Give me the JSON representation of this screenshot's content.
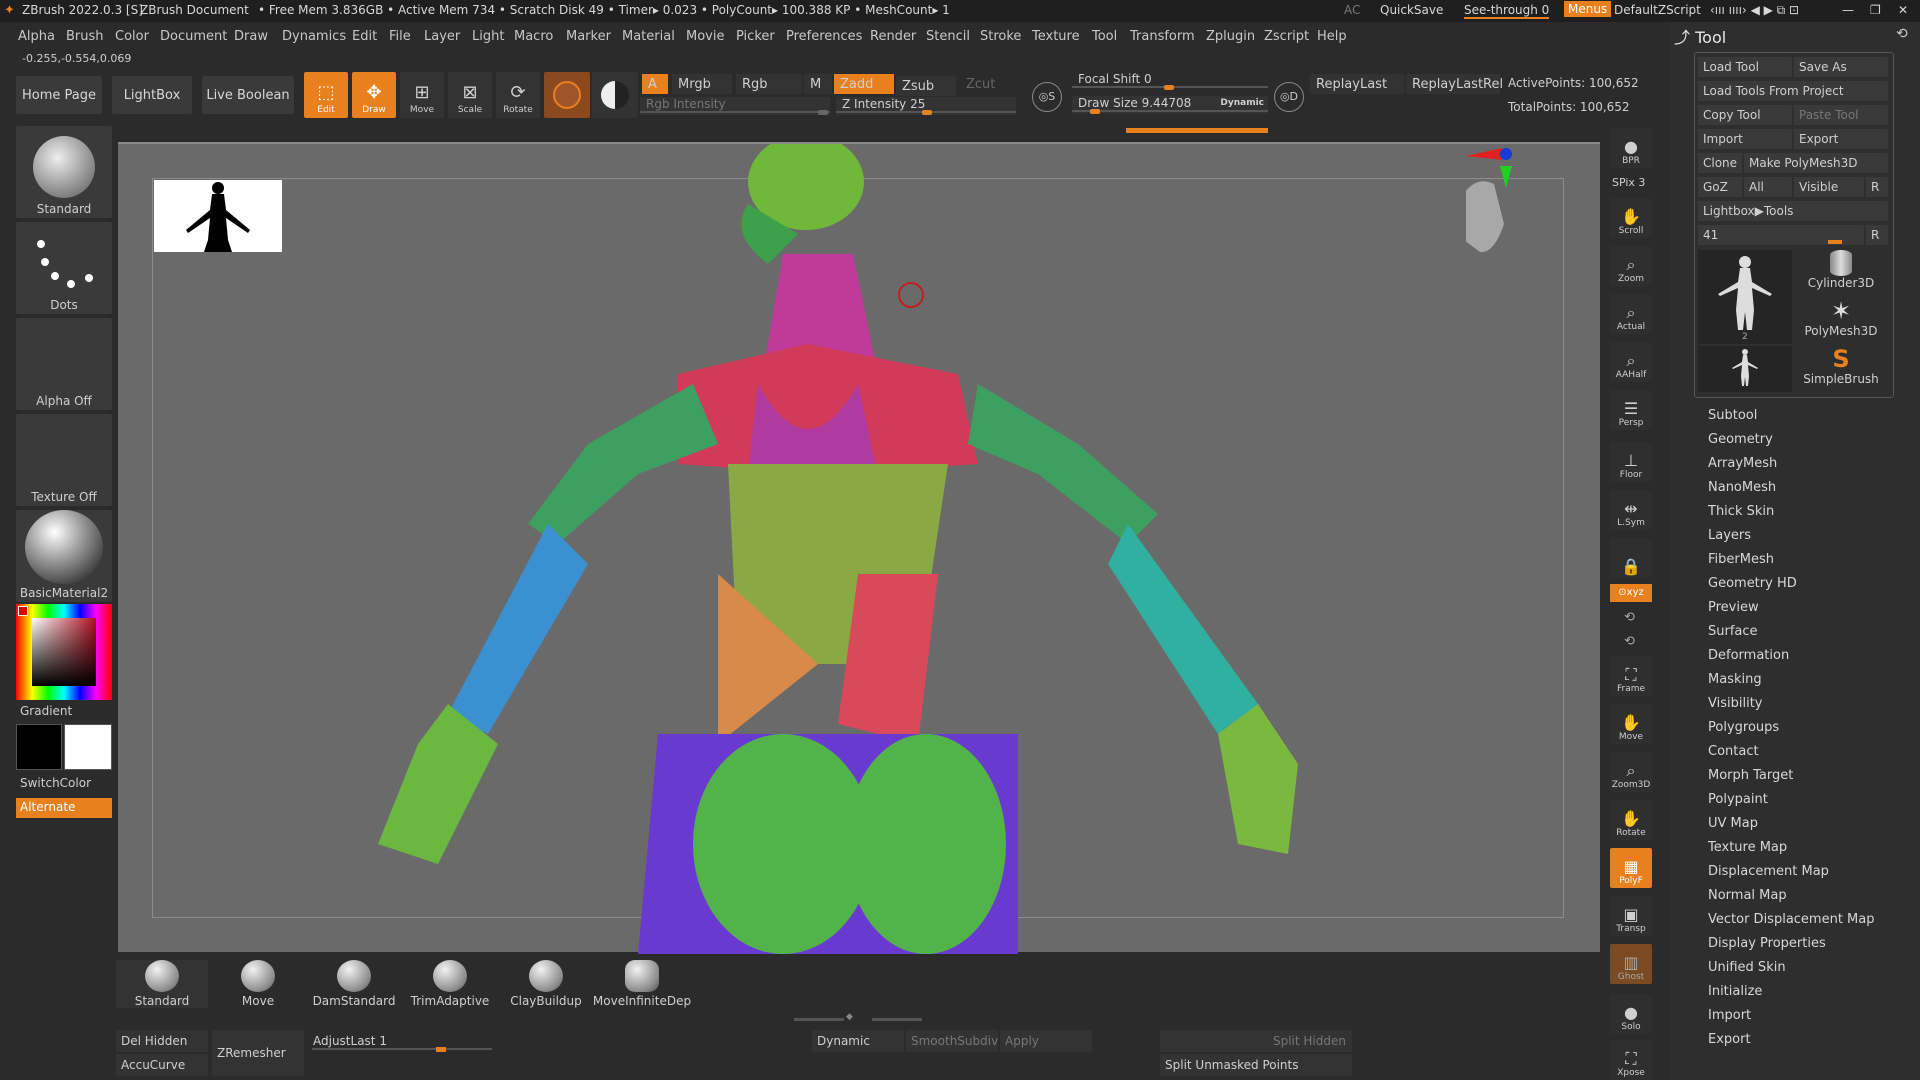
{
  "titlebar": {
    "app": "ZBrush 2022.0.3 [S]",
    "doc": "ZBrush Document",
    "stats": "• Free Mem 3.836GB • Active Mem 734 • Scratch Disk 49 •  Timer▸ 0.023 • PolyCount▸ 100.388 KP  • MeshCount▸ 1",
    "ac": "AC",
    "quicksave": "QuickSave",
    "seethrough": "See-through  0",
    "menus": "Menus",
    "script": "DefaultZScript"
  },
  "menubar": [
    "Alpha",
    "Brush",
    "Color",
    "Document",
    "Draw",
    "Dynamics",
    "Edit",
    "File",
    "Layer",
    "Light",
    "Macro",
    "Marker",
    "Material",
    "Movie",
    "Picker",
    "Preferences",
    "Render",
    "Stencil",
    "Stroke",
    "Texture",
    "Tool",
    "Transform",
    "Zplugin",
    "Zscript",
    "Help"
  ],
  "coords": "-0.255,-0.554,0.069",
  "toolbar": {
    "home": "Home Page",
    "lightbox": "LightBox",
    "live_boolean": "Live Boolean",
    "edit": "Edit",
    "draw": "Draw",
    "move": "Move",
    "scale": "Scale",
    "rotate": "Rotate",
    "a": "A",
    "mrgb": "Mrgb",
    "rgb": "Rgb",
    "m": "M",
    "zadd": "Zadd",
    "zsub": "Zsub",
    "zcut": "Zcut",
    "rgb_intensity": "Rgb Intensity",
    "z_intensity": "Z Intensity 25",
    "focal_shift": "Focal Shift 0",
    "draw_size": "Draw Size 9.44708",
    "dynamic": "Dynamic",
    "replay_last": "ReplayLast",
    "replay_last_rel": "ReplayLastRel",
    "active_points": "ActivePoints: 100,652",
    "total_points": "TotalPoints: 100,652"
  },
  "left_shelf": {
    "brush": "Standard",
    "stroke": "Dots",
    "alpha": "Alpha Off",
    "texture": "Texture Off",
    "material": "BasicMaterial2",
    "gradient": "Gradient",
    "switch_color": "SwitchColor",
    "alternate": "Alternate"
  },
  "right_shelf": [
    "BPR",
    "SPix 3",
    "Scroll",
    "Zoom",
    "Actual",
    "AAHalf",
    "Persp",
    "Floor",
    "L.Sym",
    "Frame",
    "Move",
    "Zoom3D",
    "Rotate",
    "PolyF",
    "Transp",
    "Ghost",
    "Solo",
    "Xpose"
  ],
  "tool_palette": {
    "title": "Tool",
    "load_tool": "Load Tool",
    "save_as": "Save As",
    "load_from_project": "Load Tools From Project",
    "copy_tool": "Copy Tool",
    "paste_tool": "Paste Tool",
    "import": "Import",
    "export": "Export",
    "clone": "Clone",
    "make_polymesh": "Make PolyMesh3D",
    "goz": "GoZ",
    "all": "All",
    "visible": "Visible",
    "r": "R",
    "lightbox_tools": "Lightbox▶Tools",
    "count": "41",
    "thumbs": [
      "Cylinder3D",
      "PolyMesh3D",
      "SimpleBrush"
    ],
    "thumb_num": "2",
    "subpalettes": [
      "Subtool",
      "Geometry",
      "ArrayMesh",
      "NanoMesh",
      "Thick Skin",
      "Layers",
      "FiberMesh",
      "Geometry HD",
      "Preview",
      "Surface",
      "Deformation",
      "Masking",
      "Visibility",
      "Polygroups",
      "Contact",
      "Morph Target",
      "Polypaint",
      "UV Map",
      "Texture Map",
      "Displacement Map",
      "Normal Map",
      "Vector Displacement Map",
      "Display Properties",
      "Unified Skin",
      "Initialize",
      "Import",
      "Export"
    ]
  },
  "bottom_shelf": {
    "brushes": [
      "Standard",
      "Move",
      "DamStandard",
      "TrimAdaptive",
      "ClayBuildup",
      "MoveInfiniteDep"
    ],
    "del_hidden": "Del Hidden",
    "accucurve": "AccuCurve",
    "zremesher": "ZRemesher",
    "adjust_last": "AdjustLast 1",
    "dynamic": "Dynamic",
    "smooth_subdiv": "SmoothSubdiv",
    "apply": "Apply",
    "split_hidden": "Split Hidden",
    "split_unmasked": "Split Unmasked Points"
  },
  "colors": {
    "accent": "#e8801e",
    "bg": "#2b2b2b",
    "viewport": "#6a6a6a"
  }
}
